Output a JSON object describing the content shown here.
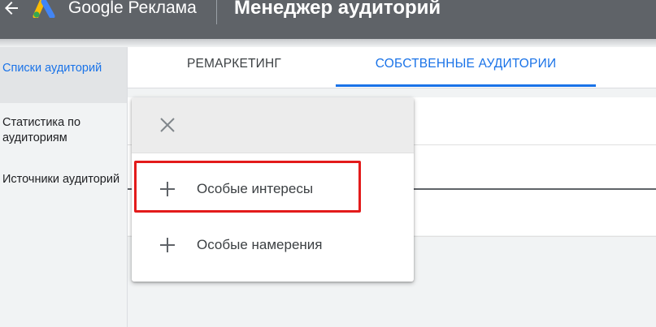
{
  "header": {
    "brand": "Google Реклама",
    "title": "Менеджер аудиторий"
  },
  "sidebar": {
    "items": [
      {
        "label": "Списки аудиторий",
        "active": true
      },
      {
        "label": "Статистика по аудиториям",
        "active": false
      },
      {
        "label": "Источники аудиторий",
        "active": false
      }
    ]
  },
  "tabs": [
    {
      "label": "РЕМАРКЕТИНГ",
      "active": false
    },
    {
      "label": "СОБСТВЕННЫЕ АУДИТОРИИ",
      "active": true
    }
  ],
  "menu": {
    "items": [
      {
        "label": "Особые интересы",
        "icon": "plus-icon",
        "highlighted": true
      },
      {
        "label": "Особые намерения",
        "icon": "plus-icon",
        "highlighted": false
      }
    ]
  },
  "colors": {
    "topbar": "#5f6368",
    "accent": "#1a73e8",
    "highlight": "#e31b1b"
  }
}
